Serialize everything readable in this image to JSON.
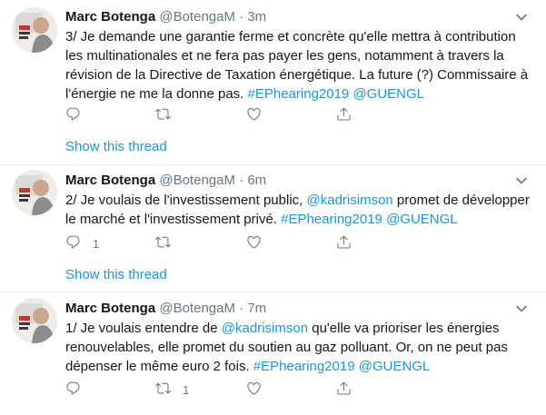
{
  "tweets": [
    {
      "name": "Marc Botenga",
      "handle": "@BotengaM",
      "dot": "·",
      "time": "3m",
      "lines": [
        [
          {
            "t": "3/ Je demande une garantie ferme et concrète qu'elle mettra à contribution"
          }
        ],
        [
          {
            "t": "les multinationales et ne fera pas payer les gens, notamment à travers la"
          }
        ],
        [
          {
            "t": "révision de la Directive de Taxation énergétique. La future (?) Commissaire à"
          }
        ],
        [
          {
            "t": "l'énergie ne me la donne pas. "
          },
          {
            "t": "#EPhearing2019",
            "link": true
          },
          {
            "t": " "
          },
          {
            "t": "@GUENGL",
            "link": true
          }
        ]
      ],
      "reply_count": "",
      "retweet_count": "",
      "like_count": "",
      "show_thread": "Show this thread"
    },
    {
      "name": "Marc Botenga",
      "handle": "@BotengaM",
      "dot": "·",
      "time": "6m",
      "lines": [
        [
          {
            "t": "2/ Je voulais de l'investissement public, "
          },
          {
            "t": "@kadrisimson",
            "link": true
          },
          {
            "t": " promet de développer"
          }
        ],
        [
          {
            "t": "le marché et l'investissement privé. "
          },
          {
            "t": "#EPhearing2019",
            "link": true
          },
          {
            "t": " "
          },
          {
            "t": "@GUENGL",
            "link": true
          }
        ]
      ],
      "reply_count": "1",
      "retweet_count": "",
      "like_count": "",
      "show_thread": "Show this thread"
    },
    {
      "name": "Marc Botenga",
      "handle": "@BotengaM",
      "dot": "·",
      "time": "7m",
      "lines": [
        [
          {
            "t": "1/ Je voulais entendre de "
          },
          {
            "t": "@kadrisimson",
            "link": true
          },
          {
            "t": " qu'elle va prioriser les énergies"
          }
        ],
        [
          {
            "t": "renouvelables, elle promet du soutien au gaz polluant. Or, on ne peut pas"
          }
        ],
        [
          {
            "t": "dépenser le même euro 2 fois. "
          },
          {
            "t": "#EPhearing2019",
            "link": true
          },
          {
            "t": " "
          },
          {
            "t": "@GUENGL",
            "link": true
          }
        ]
      ],
      "reply_count": "",
      "retweet_count": "1",
      "like_count": "",
      "show_thread": ""
    }
  ],
  "icons": {
    "reply": "reply-icon",
    "retweet": "retweet-icon",
    "like": "heart-icon",
    "share": "share-icon",
    "more": "chevron-down-icon"
  },
  "colors": {
    "text": "#14171a",
    "secondary": "#657786",
    "link": "#1b95e0",
    "divider": "#e6ecf0"
  }
}
